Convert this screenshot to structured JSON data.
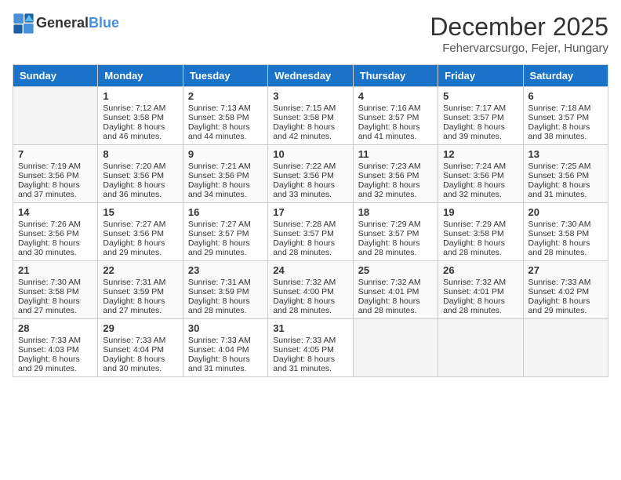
{
  "header": {
    "logo_general": "General",
    "logo_blue": "Blue",
    "month": "December 2025",
    "location": "Fehervarcsurgo, Fejer, Hungary"
  },
  "weekdays": [
    "Sunday",
    "Monday",
    "Tuesday",
    "Wednesday",
    "Thursday",
    "Friday",
    "Saturday"
  ],
  "weeks": [
    [
      {
        "day": "",
        "empty": true
      },
      {
        "day": "1",
        "sunrise": "Sunrise: 7:12 AM",
        "sunset": "Sunset: 3:58 PM",
        "daylight": "Daylight: 8 hours and 46 minutes."
      },
      {
        "day": "2",
        "sunrise": "Sunrise: 7:13 AM",
        "sunset": "Sunset: 3:58 PM",
        "daylight": "Daylight: 8 hours and 44 minutes."
      },
      {
        "day": "3",
        "sunrise": "Sunrise: 7:15 AM",
        "sunset": "Sunset: 3:58 PM",
        "daylight": "Daylight: 8 hours and 42 minutes."
      },
      {
        "day": "4",
        "sunrise": "Sunrise: 7:16 AM",
        "sunset": "Sunset: 3:57 PM",
        "daylight": "Daylight: 8 hours and 41 minutes."
      },
      {
        "day": "5",
        "sunrise": "Sunrise: 7:17 AM",
        "sunset": "Sunset: 3:57 PM",
        "daylight": "Daylight: 8 hours and 39 minutes."
      },
      {
        "day": "6",
        "sunrise": "Sunrise: 7:18 AM",
        "sunset": "Sunset: 3:57 PM",
        "daylight": "Daylight: 8 hours and 38 minutes."
      }
    ],
    [
      {
        "day": "7",
        "sunrise": "Sunrise: 7:19 AM",
        "sunset": "Sunset: 3:56 PM",
        "daylight": "Daylight: 8 hours and 37 minutes."
      },
      {
        "day": "8",
        "sunrise": "Sunrise: 7:20 AM",
        "sunset": "Sunset: 3:56 PM",
        "daylight": "Daylight: 8 hours and 36 minutes."
      },
      {
        "day": "9",
        "sunrise": "Sunrise: 7:21 AM",
        "sunset": "Sunset: 3:56 PM",
        "daylight": "Daylight: 8 hours and 34 minutes."
      },
      {
        "day": "10",
        "sunrise": "Sunrise: 7:22 AM",
        "sunset": "Sunset: 3:56 PM",
        "daylight": "Daylight: 8 hours and 33 minutes."
      },
      {
        "day": "11",
        "sunrise": "Sunrise: 7:23 AM",
        "sunset": "Sunset: 3:56 PM",
        "daylight": "Daylight: 8 hours and 32 minutes."
      },
      {
        "day": "12",
        "sunrise": "Sunrise: 7:24 AM",
        "sunset": "Sunset: 3:56 PM",
        "daylight": "Daylight: 8 hours and 32 minutes."
      },
      {
        "day": "13",
        "sunrise": "Sunrise: 7:25 AM",
        "sunset": "Sunset: 3:56 PM",
        "daylight": "Daylight: 8 hours and 31 minutes."
      }
    ],
    [
      {
        "day": "14",
        "sunrise": "Sunrise: 7:26 AM",
        "sunset": "Sunset: 3:56 PM",
        "daylight": "Daylight: 8 hours and 30 minutes."
      },
      {
        "day": "15",
        "sunrise": "Sunrise: 7:27 AM",
        "sunset": "Sunset: 3:56 PM",
        "daylight": "Daylight: 8 hours and 29 minutes."
      },
      {
        "day": "16",
        "sunrise": "Sunrise: 7:27 AM",
        "sunset": "Sunset: 3:57 PM",
        "daylight": "Daylight: 8 hours and 29 minutes."
      },
      {
        "day": "17",
        "sunrise": "Sunrise: 7:28 AM",
        "sunset": "Sunset: 3:57 PM",
        "daylight": "Daylight: 8 hours and 28 minutes."
      },
      {
        "day": "18",
        "sunrise": "Sunrise: 7:29 AM",
        "sunset": "Sunset: 3:57 PM",
        "daylight": "Daylight: 8 hours and 28 minutes."
      },
      {
        "day": "19",
        "sunrise": "Sunrise: 7:29 AM",
        "sunset": "Sunset: 3:58 PM",
        "daylight": "Daylight: 8 hours and 28 minutes."
      },
      {
        "day": "20",
        "sunrise": "Sunrise: 7:30 AM",
        "sunset": "Sunset: 3:58 PM",
        "daylight": "Daylight: 8 hours and 28 minutes."
      }
    ],
    [
      {
        "day": "21",
        "sunrise": "Sunrise: 7:30 AM",
        "sunset": "Sunset: 3:58 PM",
        "daylight": "Daylight: 8 hours and 27 minutes."
      },
      {
        "day": "22",
        "sunrise": "Sunrise: 7:31 AM",
        "sunset": "Sunset: 3:59 PM",
        "daylight": "Daylight: 8 hours and 27 minutes."
      },
      {
        "day": "23",
        "sunrise": "Sunrise: 7:31 AM",
        "sunset": "Sunset: 3:59 PM",
        "daylight": "Daylight: 8 hours and 28 minutes."
      },
      {
        "day": "24",
        "sunrise": "Sunrise: 7:32 AM",
        "sunset": "Sunset: 4:00 PM",
        "daylight": "Daylight: 8 hours and 28 minutes."
      },
      {
        "day": "25",
        "sunrise": "Sunrise: 7:32 AM",
        "sunset": "Sunset: 4:01 PM",
        "daylight": "Daylight: 8 hours and 28 minutes."
      },
      {
        "day": "26",
        "sunrise": "Sunrise: 7:32 AM",
        "sunset": "Sunset: 4:01 PM",
        "daylight": "Daylight: 8 hours and 28 minutes."
      },
      {
        "day": "27",
        "sunrise": "Sunrise: 7:33 AM",
        "sunset": "Sunset: 4:02 PM",
        "daylight": "Daylight: 8 hours and 29 minutes."
      }
    ],
    [
      {
        "day": "28",
        "sunrise": "Sunrise: 7:33 AM",
        "sunset": "Sunset: 4:03 PM",
        "daylight": "Daylight: 8 hours and 29 minutes."
      },
      {
        "day": "29",
        "sunrise": "Sunrise: 7:33 AM",
        "sunset": "Sunset: 4:04 PM",
        "daylight": "Daylight: 8 hours and 30 minutes."
      },
      {
        "day": "30",
        "sunrise": "Sunrise: 7:33 AM",
        "sunset": "Sunset: 4:04 PM",
        "daylight": "Daylight: 8 hours and 31 minutes."
      },
      {
        "day": "31",
        "sunrise": "Sunrise: 7:33 AM",
        "sunset": "Sunset: 4:05 PM",
        "daylight": "Daylight: 8 hours and 31 minutes."
      },
      {
        "day": "",
        "empty": true
      },
      {
        "day": "",
        "empty": true
      },
      {
        "day": "",
        "empty": true
      }
    ]
  ]
}
